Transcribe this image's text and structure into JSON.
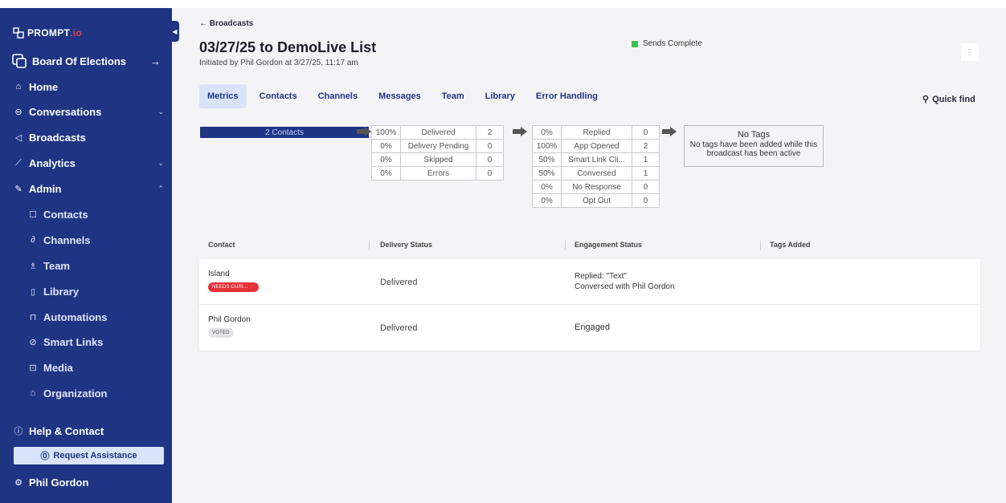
{
  "sidebar": {
    "logo_text": "PROMPT",
    "logo_suffix": ".io",
    "org_name": "Board Of Elections",
    "nav": [
      {
        "label": "Home",
        "icon": "home-icon"
      },
      {
        "label": "Conversations",
        "icon": "conversations-icon"
      },
      {
        "label": "Broadcasts",
        "icon": "broadcast-icon"
      },
      {
        "label": "Analytics",
        "icon": "analytics-icon"
      },
      {
        "label": "Admin",
        "icon": "admin-icon"
      }
    ],
    "admin_sub": [
      "Contacts",
      "Channels",
      "Team",
      "Library",
      "Automations",
      "Smart Links",
      "Media",
      "Organization"
    ],
    "help_label": "Help & Contact",
    "request_label": "Request Assistance",
    "user_name": "Phil Gordon"
  },
  "header": {
    "breadcrumb": "← Broadcasts",
    "title": "03/27/25 to DemoLive List",
    "subtitle": "Initiated by Phil Gordon at 3/27/25, 11:17 am",
    "status": "Sends Complete",
    "status_color": "#3fbf4f",
    "kebab": "⋮"
  },
  "tabs": [
    "Metrics",
    "Contacts",
    "Channels",
    "Messages",
    "Team",
    "Library",
    "Error Handling"
  ],
  "active_tab": "Metrics",
  "quick_find": "Quick find",
  "funnel": {
    "contacts_label": "2 Contacts",
    "delivery": [
      {
        "pct": "100%",
        "label": "Delivered",
        "count": "2"
      },
      {
        "pct": "0%",
        "label": "Delivery Pending",
        "count": "0"
      },
      {
        "pct": "0%",
        "label": "Skipped",
        "count": "0"
      },
      {
        "pct": "0%",
        "label": "Errors",
        "count": "0"
      }
    ],
    "engagement": [
      {
        "pct": "0%",
        "label": "Replied",
        "count": "0"
      },
      {
        "pct": "100%",
        "label": "App Opened",
        "count": "2"
      },
      {
        "pct": "50%",
        "label": "Smart Link Cli...",
        "count": "1"
      },
      {
        "pct": "50%",
        "label": "Conversed",
        "count": "1"
      },
      {
        "pct": "0%",
        "label": "No Response",
        "count": "0"
      },
      {
        "pct": "0%",
        "label": "Opt Out",
        "count": "0"
      }
    ],
    "tags_title": "No Tags",
    "tags_body": "No tags have been added while this broadcast has been active"
  },
  "table": {
    "headers": [
      "Contact",
      "Delivery Status",
      "Engagement Status",
      "Tags Added"
    ],
    "rows": [
      {
        "name": "Island",
        "badge": "NEEDS CURI...",
        "badge_color": "#e8303a",
        "delivery": "Delivered",
        "engagement": [
          "Replied: \"Text\"",
          "Conversed with Phil Gordon"
        ]
      },
      {
        "name": "Phil Gordon",
        "badge": "VOTED",
        "badge_color": "#e4e4e8",
        "delivery": "Delivered",
        "engagement": [
          "Engaged"
        ]
      }
    ]
  }
}
